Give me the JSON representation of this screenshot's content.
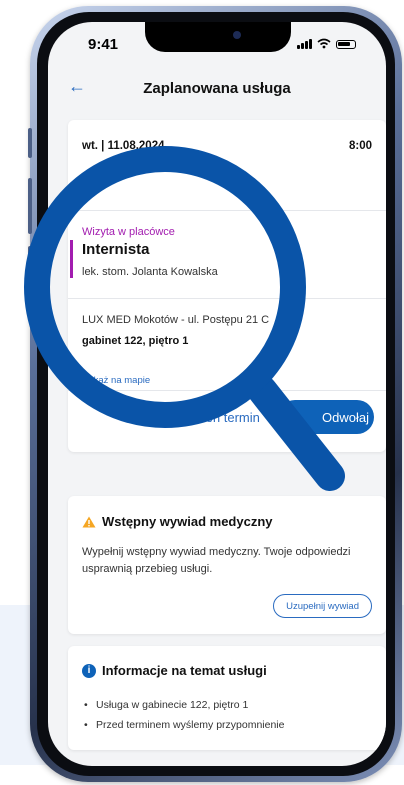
{
  "status_bar": {
    "time": "9:41"
  },
  "header": {
    "back_icon": "arrow-left-icon",
    "title": "Zaplanowana usługa"
  },
  "appointment": {
    "date": "wt. | 11.08.2024",
    "time": "8:00",
    "visit_type": "Wizyta w placówce",
    "specialty": "Internista",
    "doctor": "lek. stom. Jolanta Kowalska",
    "clinic": "LUX MED Mokotów - ul. Postępu 21 C",
    "room": "gabinet 122, piętro 1",
    "map_link": "Pokaż na mapie",
    "change_label": "Zmień termin",
    "cancel_label": "Odwołaj"
  },
  "survey": {
    "icon": "warning-icon",
    "title": "Wstępny wywiad medyczny",
    "body": "Wypełnij wstępny wywiad medyczny. Twoje odpowiedzi usprawnią przebieg usługi.",
    "button_label": "Uzupełnij wywiad"
  },
  "info": {
    "icon": "info-icon",
    "title": "Informacje na temat usługi",
    "items": [
      "Usługa w gabinecie 122, piętro 1",
      "Przed terminem wyślemy przypomnienie"
    ]
  },
  "colors": {
    "brand_blue": "#0e62b8",
    "link_blue": "#2a6bc0",
    "visit_accent": "#a21caf",
    "warning": "#f5a623"
  }
}
